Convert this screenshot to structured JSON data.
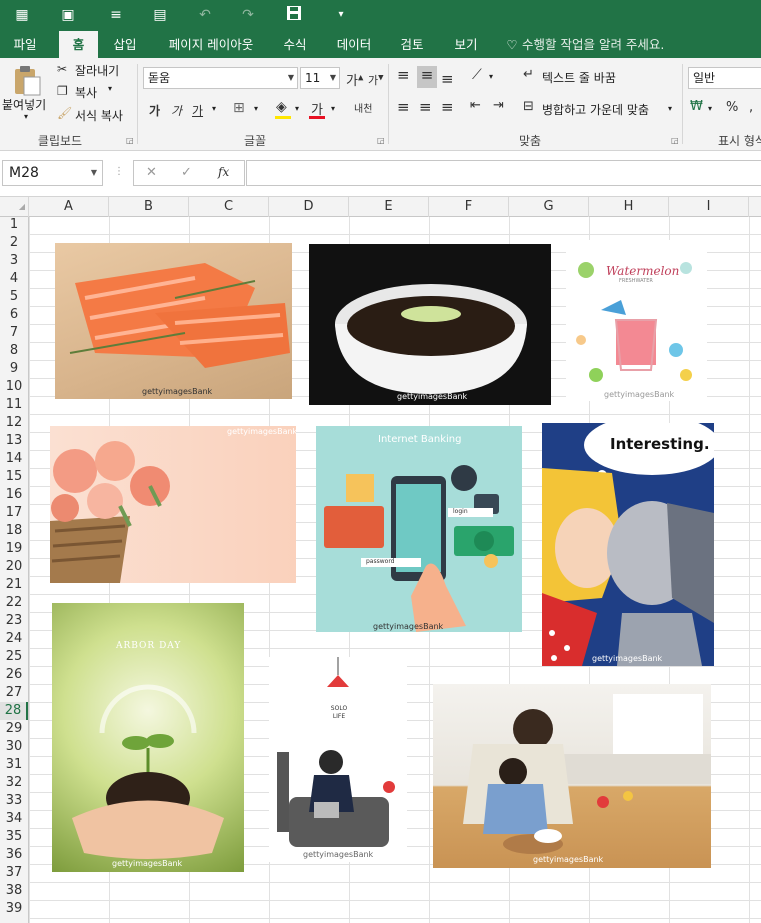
{
  "qat": {
    "icons": [
      "autosave-icon",
      "touch-mode-icon",
      "align-icon",
      "form-icon",
      "undo-icon",
      "redo-icon",
      "save-icon",
      "customize-icon"
    ]
  },
  "tabs": [
    "파일",
    "홈",
    "삽입",
    "페이지 레이아웃",
    "수식",
    "데이터",
    "검토",
    "보기"
  ],
  "tell_me": "수행할 작업을 알려 주세요.",
  "ribbon": {
    "clipboard": {
      "paste": "붙여넣기",
      "cut": "잘라내기",
      "copy": "복사",
      "format_painter": "서식 복사",
      "label": "클립보드"
    },
    "font": {
      "name": "돋움",
      "size": "11",
      "bold": "가",
      "italic": "가",
      "underline": "가",
      "label": "글꼴",
      "phonetic": "내천"
    },
    "alignment": {
      "wrap": "텍스트 줄 바꿈",
      "merge": "병합하고 가운데 맞춤",
      "label": "맞춤"
    },
    "number": {
      "format": "일반",
      "label": "표시 형식",
      "percent": "%"
    },
    "colors": {
      "fill": "#FFE600",
      "font": "#E81123",
      "accent": "#217346"
    }
  },
  "formula_bar": {
    "name_box": "M28",
    "cancel": "✕",
    "enter": "✓",
    "fx": "fx",
    "formula": ""
  },
  "columns": [
    "A",
    "B",
    "C",
    "D",
    "E",
    "F",
    "G",
    "H",
    "I"
  ],
  "rows": [
    "1",
    "2",
    "3",
    "4",
    "5",
    "6",
    "7",
    "8",
    "9",
    "10",
    "11",
    "12",
    "13",
    "14",
    "15",
    "16",
    "17",
    "18",
    "19",
    "20",
    "21",
    "22",
    "23",
    "24",
    "25",
    "26",
    "27",
    "28",
    "29",
    "30",
    "31",
    "32",
    "33",
    "34",
    "35",
    "36",
    "37",
    "38",
    "39"
  ],
  "selected_row": "28",
  "images": [
    {
      "name": "salmon-image",
      "watermark": "gettyimagesBank"
    },
    {
      "name": "jajangmyeon-image",
      "watermark": "gettyimagesBank"
    },
    {
      "name": "watermelon-juice-image",
      "title": "Watermelon",
      "subtitle": "FRESHWATER",
      "watermark": "gettyimagesBank"
    },
    {
      "name": "tulips-image",
      "watermark": "gettyimagesBank"
    },
    {
      "name": "internet-banking-image",
      "title": "Internet Banking",
      "login": "login",
      "password": "password",
      "watermark": "gettyimagesBank"
    },
    {
      "name": "pop-art-robot-image",
      "caption": "Interesting.",
      "watermark": "gettyimagesBank"
    },
    {
      "name": "arbor-day-image",
      "title": "ARBOR DAY",
      "watermark": "gettyimagesBank"
    },
    {
      "name": "solo-life-image",
      "title": "SOLO LIFE",
      "watermark": "gettyimagesBank"
    },
    {
      "name": "father-child-cooking-image",
      "watermark": "gettyimagesBank"
    }
  ]
}
